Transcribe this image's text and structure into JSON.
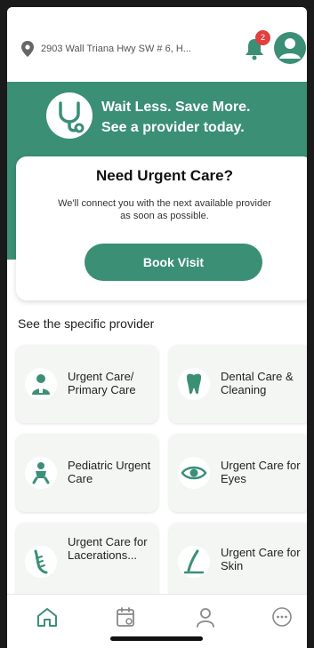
{
  "header": {
    "location": "2903 Wall Triana Hwy SW # 6, H...",
    "notification_count": "2"
  },
  "hero": {
    "line1": "Wait Less. Save More.",
    "line2": "See a provider today."
  },
  "urgent": {
    "title": "Need Urgent Care?",
    "description": "We'll connect you with the next available provider as soon as possible.",
    "button": "Book Visit"
  },
  "providers": {
    "section_label": "See the specific provider",
    "items": [
      {
        "label": "Urgent Care/ Primary Care",
        "icon": "doctor-icon"
      },
      {
        "label": "Dental Care & Cleaning",
        "icon": "tooth-icon"
      },
      {
        "label": "Pediatric Urgent Care",
        "icon": "baby-icon"
      },
      {
        "label": "Urgent Care for Eyes",
        "icon": "eye-icon"
      },
      {
        "label": "Urgent Care for Lacerations...",
        "icon": "bandage-icon"
      },
      {
        "label": "Urgent Care for Skin",
        "icon": "skin-icon"
      }
    ]
  },
  "nav": {
    "items": [
      "home-icon",
      "calendar-icon",
      "profile-icon",
      "more-icon"
    ]
  },
  "colors": {
    "brand": "#3b8f75",
    "badge": "#e04040"
  }
}
